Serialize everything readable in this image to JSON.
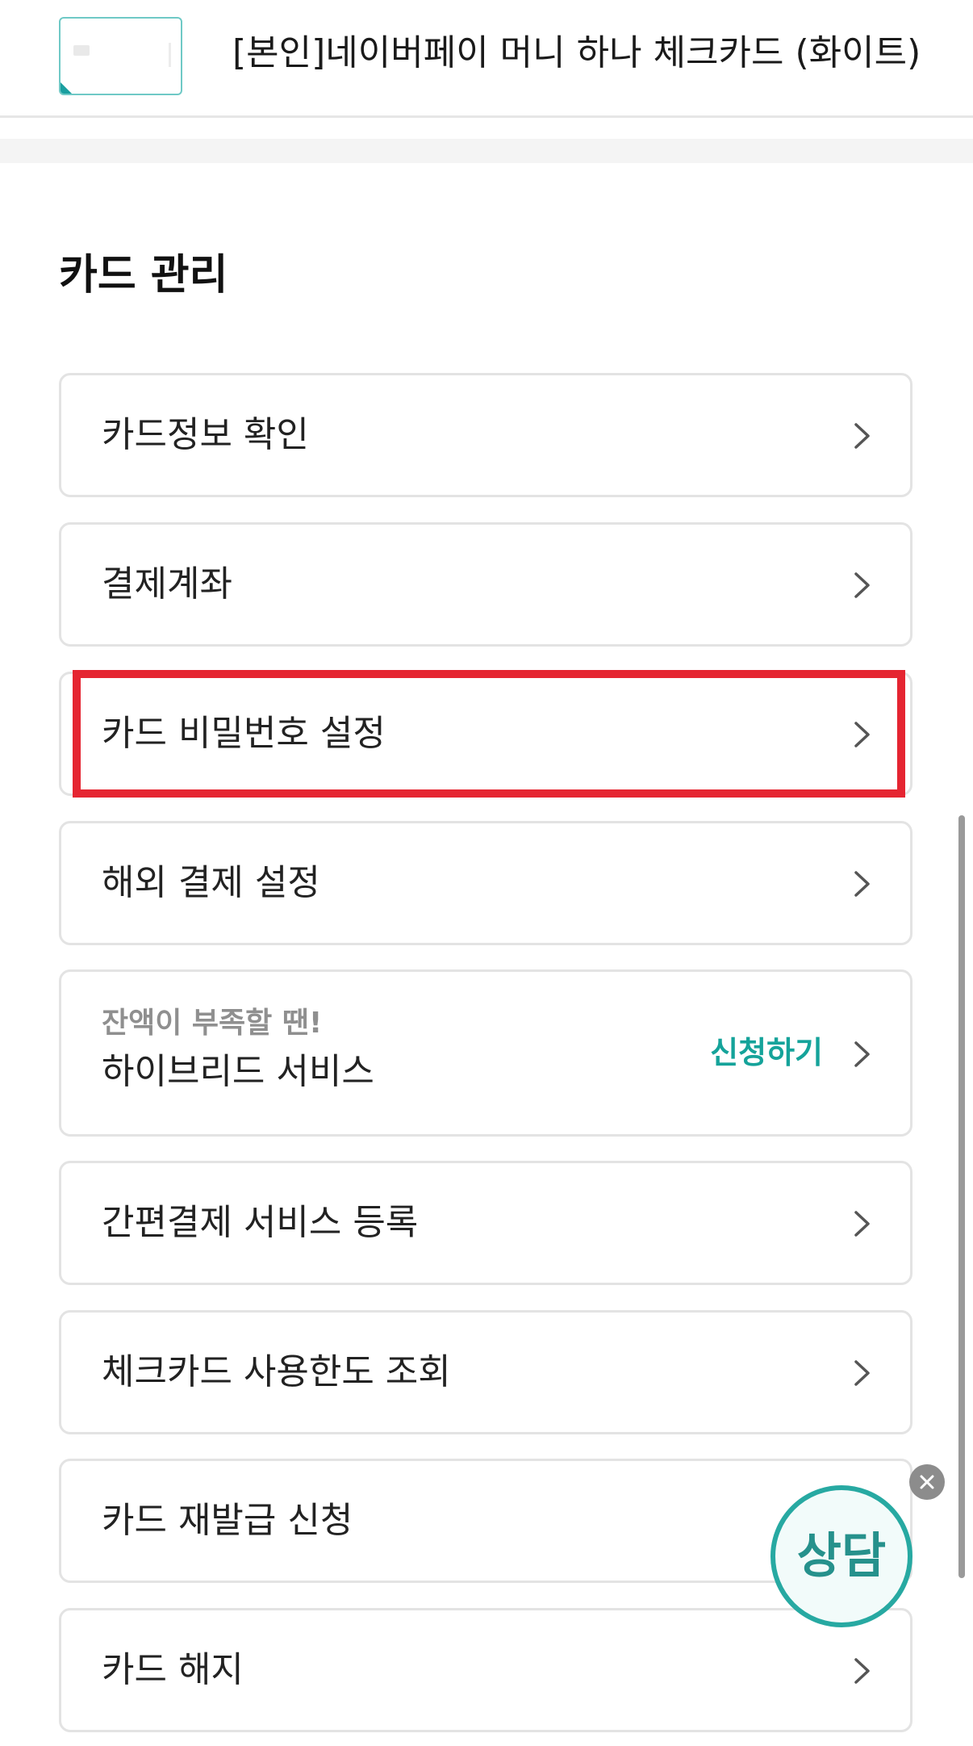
{
  "card": {
    "name": "[본인]네이버페이 머니 하나 체크카드 (화이트)",
    "accent_color": "#1a9fa0"
  },
  "section": {
    "title": "카드 관리"
  },
  "menu": {
    "items": [
      {
        "label": "카드정보 확인",
        "icon": "chevron-right-icon"
      },
      {
        "label": "결제계좌",
        "icon": "chevron-right-icon"
      },
      {
        "label": "카드 비밀번호 설정",
        "icon": "chevron-right-icon",
        "highlighted": true,
        "highlight_color": "#e52531"
      },
      {
        "label": "해외 결제 설정",
        "icon": "chevron-right-icon"
      },
      {
        "sublabel": "잔액이 부족할 땐!",
        "label": "하이브리드 서비스",
        "action": "신청하기",
        "action_color": "#15a39a",
        "icon": "chevron-right-icon"
      },
      {
        "label": "간편결제 서비스 등록",
        "icon": "chevron-right-icon"
      },
      {
        "label": "체크카드 사용한도 조회",
        "icon": "chevron-right-icon"
      },
      {
        "label": "카드 재발급 신청",
        "icon": "chevron-right-icon"
      },
      {
        "label": "카드 해지",
        "icon": "chevron-right-icon"
      }
    ]
  },
  "consult": {
    "label": "상담",
    "color": "#27a9a2",
    "close_icon": "close-icon"
  }
}
